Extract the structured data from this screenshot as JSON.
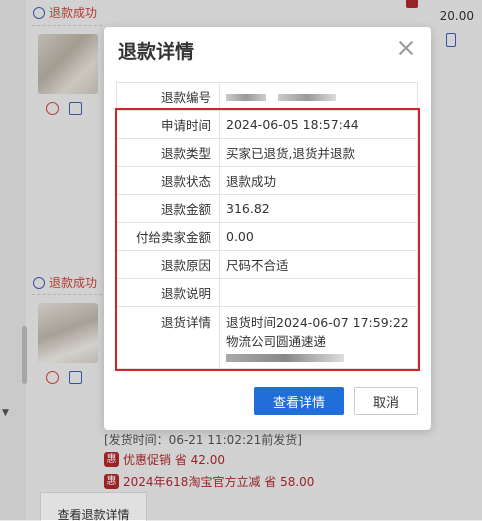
{
  "background": {
    "status1": "退款成功",
    "status2": "退款成功",
    "price": "20.00",
    "shipping": "[发货时间：06-21 11:02:21前发货]",
    "promo1": "优惠促销 省 42.00",
    "promo2": "2024年618淘宝官方立减 省 58.00",
    "promo_badge": "惠",
    "tab_label": "查看退款详情"
  },
  "modal": {
    "title": "退款详情",
    "rows": [
      {
        "label": "退款编号",
        "value": ""
      },
      {
        "label": "申请时间",
        "value": "2024-06-05 18:57:44"
      },
      {
        "label": "退款类型",
        "value": "买家已退货,退货并退款"
      },
      {
        "label": "退款状态",
        "value": "退款成功"
      },
      {
        "label": "退款金额",
        "value": "316.82"
      },
      {
        "label": "付给卖家金额",
        "value": "0.00"
      },
      {
        "label": "退款原因",
        "value": "尺码不合适"
      },
      {
        "label": "退款说明",
        "value": ""
      },
      {
        "label": "退货详情",
        "value": "退货时间2024-06-07 17:59:22",
        "value2": "物流公司圆通速递"
      }
    ],
    "primary_button": "查看详情",
    "cancel_button": "取消"
  },
  "colors": {
    "accent": "#1f6ed9",
    "highlight_border": "#d4212a",
    "status_red": "#d0433a"
  }
}
